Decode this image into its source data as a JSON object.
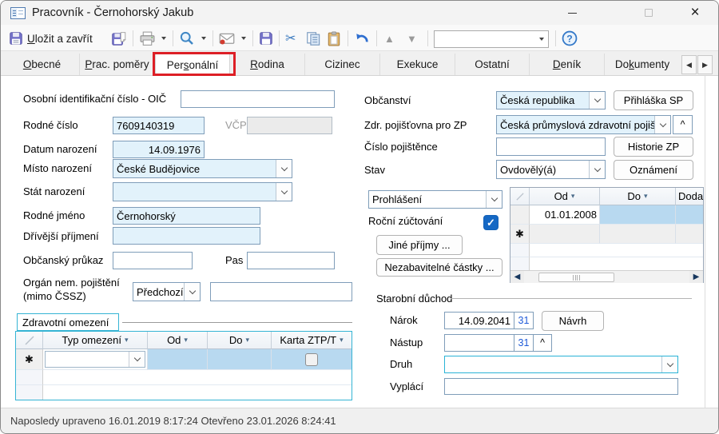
{
  "colors": {
    "field_blue": "#e2f2fb",
    "field_border": "#7f9db9",
    "cyan_accent": "#35b4d4",
    "annotation_red": "#dd1f26",
    "checkbox_blue": "#1568c4",
    "grid_cell_blue": "#b8d9f0"
  },
  "icons": {
    "sort_arrow": "▾",
    "new_row_marker": "✱",
    "check": "✓",
    "scissors": "✂",
    "tab_prev": "◀",
    "tab_next": "▶",
    "scroll_left": "◀",
    "scroll_right": "▶",
    "up_arrow": "▲",
    "down_arrow": "▼",
    "caret_up": "^"
  },
  "window": {
    "title": "Pracovník - Černohorský Jakub"
  },
  "toolbar": {
    "save_close": {
      "pre": "",
      "accel": "U",
      "post": "ložit a zavřít"
    }
  },
  "tab_bar": {
    "tabs": [
      {
        "pre": "",
        "accel": "O",
        "post": "becné"
      },
      {
        "pre": "",
        "accel": "P",
        "post": "rac. poměry"
      },
      {
        "pre": "Per",
        "accel": "s",
        "post": "onální"
      },
      {
        "pre": "",
        "accel": "R",
        "post": "odina"
      },
      {
        "pre": "Cizinec",
        "accel": "",
        "post": ""
      },
      {
        "pre": "Exekuce",
        "accel": "",
        "post": ""
      },
      {
        "pre": "Ostatní",
        "accel": "",
        "post": ""
      },
      {
        "pre": "",
        "accel": "D",
        "post": "eník"
      },
      {
        "pre": "Do",
        "accel": "k",
        "post": "umenty"
      }
    ],
    "active_tab": "Personální"
  },
  "form": {
    "oic_label": "Osobní identifikační číslo - OIČ",
    "oic_value": "",
    "rodne_cislo_label": "Rodné číslo",
    "rodne_cislo_value": "7609140319",
    "vcp_label": "VČP",
    "vcp_value": "",
    "datum_narozeni_label": "Datum narození",
    "datum_narozeni_value": "14.09.1976",
    "misto_narozeni_label": "Místo narození",
    "misto_narozeni_value": "České Budějovice",
    "stat_narozeni_label": "Stát narození",
    "stat_narozeni_value": "",
    "rodne_jmeno_label": "Rodné jméno",
    "rodne_jmeno_value": "Černohorský",
    "drivejsi_prijmeni_label": "Dřívější příjmení",
    "drivejsi_prijmeni_value": "",
    "obcansky_prukaz_label": "Občanský průkaz",
    "obcansky_prukaz_value": "",
    "pas_label": "Pas",
    "pas_value": "",
    "organ_label_line1": "Orgán nem. pojištění",
    "organ_label_line2": "(mimo ČSSZ)",
    "organ_select_value": "Předchozí",
    "organ_text_value": ""
  },
  "zdravotni_omezeni": {
    "title": "Zdravotní omezení",
    "columns": [
      "Typ omezení",
      "Od",
      "Do",
      "Karta ZTP/T"
    ]
  },
  "right_form": {
    "obcanstvi_label": "Občanství",
    "obcanstvi_value": "Česká republika",
    "prihlaska_sp_button": "Přihláška SP",
    "zdr_pojistovna_label": "Zdr. pojišťovna pro ZP",
    "zdr_pojistovna_value": "Česká průmyslová zdravotní pojišťovna",
    "cislo_pojistence_label": "Číslo pojištěnce",
    "cislo_pojistence_value": "",
    "historie_zp_button": "Historie ZP",
    "stav_label": "Stav",
    "stav_value": "Ovdovělý(á)",
    "oznameni_button": "Oznámení",
    "prohlaseni_value": "Prohlášení",
    "rocni_zuctovani_label": "Roční zúčtování",
    "rocni_zuctovani_checked": true,
    "jine_prijmy_button": "Jiné příjmy ...",
    "nezabavitelne_button": "Nezabavitelné částky ..."
  },
  "prohlaseni_grid": {
    "columns": [
      "Od",
      "Do",
      "Doda"
    ],
    "row1_od": "01.01.2008"
  },
  "starobni_duchod": {
    "title": "Starobní důchod",
    "narok_label": "Nárok",
    "narok_value": "14.09.2041",
    "calendar_button": "31",
    "navrh_button": "Návrh",
    "nastup_label": "Nástup",
    "nastup_value": "",
    "druh_label": "Druh",
    "druh_value": "",
    "vyplaci_label": "Vyplácí",
    "vyplaci_value": ""
  },
  "status_bar": {
    "text": "Naposledy upraveno 16.01.2019 8:17:24 Otevřeno 23.01.2026 8:24:41"
  }
}
